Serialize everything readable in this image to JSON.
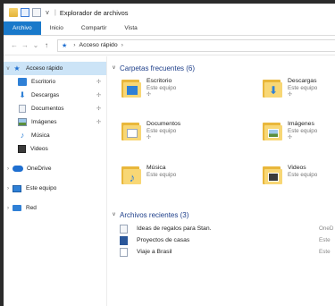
{
  "window": {
    "title": "Explorador de archivos"
  },
  "ribbon": {
    "tabs": [
      {
        "label": "Archivo",
        "active": true
      },
      {
        "label": "Inicio",
        "active": false
      },
      {
        "label": "Compartir",
        "active": false
      },
      {
        "label": "Vista",
        "active": false
      }
    ]
  },
  "address": {
    "path": "Acceso rápido"
  },
  "nav": {
    "quick_access": {
      "label": "Acceso rápido",
      "items": [
        {
          "label": "Escritorio",
          "icon": "desktop-icon",
          "pinned": true
        },
        {
          "label": "Descargas",
          "icon": "downloads-icon",
          "pinned": true
        },
        {
          "label": "Documentos",
          "icon": "documents-icon",
          "pinned": true
        },
        {
          "label": "Imágenes",
          "icon": "pictures-icon",
          "pinned": true
        },
        {
          "label": "Música",
          "icon": "music-icon",
          "pinned": false
        },
        {
          "label": "Videos",
          "icon": "videos-icon",
          "pinned": false
        }
      ]
    },
    "onedrive": {
      "label": "OneDrive"
    },
    "this_pc": {
      "label": "Este equipo"
    },
    "network": {
      "label": "Red"
    }
  },
  "frequent": {
    "header": "Carpetas frecuentes (6)",
    "folders": [
      {
        "name": "Escritorio",
        "location": "Este equipo",
        "pinned": true
      },
      {
        "name": "Descargas",
        "location": "Este equipo",
        "pinned": true
      },
      {
        "name": "Documentos",
        "location": "Este equipo",
        "pinned": true
      },
      {
        "name": "Imágenes",
        "location": "Este equipo",
        "pinned": true
      },
      {
        "name": "Música",
        "location": "Este equipo",
        "pinned": false
      },
      {
        "name": "Videos",
        "location": "Este equipo",
        "pinned": false
      }
    ]
  },
  "recent": {
    "header": "Archivos recientes (3)",
    "files": [
      {
        "name": "Ideas de regalos para Stan.",
        "location": "OneD"
      },
      {
        "name": "Proyectos de casas",
        "location": "Este"
      },
      {
        "name": "Viaje a Brasil",
        "location": "Este"
      }
    ]
  },
  "glyphs": {
    "pin": "✢",
    "chevron": "›",
    "caret_down": "v"
  }
}
